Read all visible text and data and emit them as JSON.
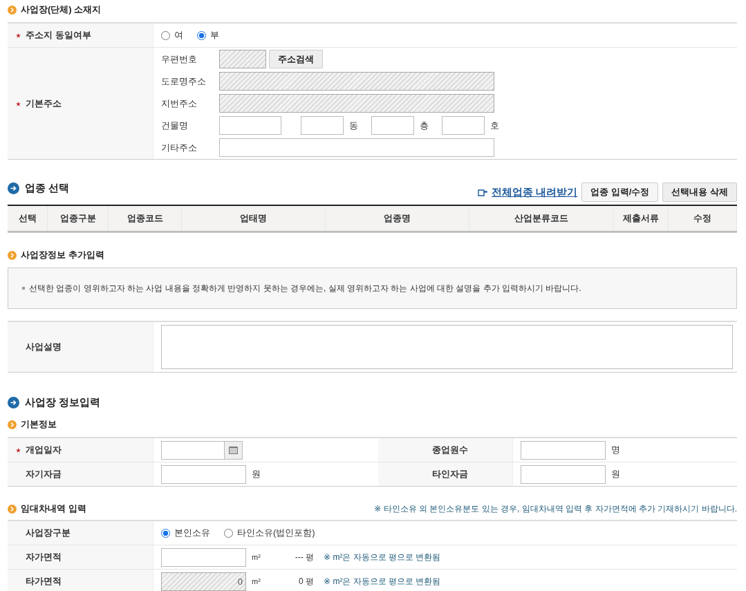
{
  "location": {
    "title": "사업장(단체) 소재지",
    "same_address": {
      "label": "주소지 동일여부",
      "required": true,
      "options": [
        {
          "label": "여",
          "selected": false
        },
        {
          "label": "부",
          "selected": true
        }
      ]
    },
    "basic_address": {
      "label": "기본주소",
      "required": true,
      "fields": [
        {
          "kind": "postcode",
          "label": "우편번호",
          "disabled": true,
          "button": "주소검색"
        },
        {
          "kind": "wide",
          "label": "도로명주소",
          "disabled": true
        },
        {
          "kind": "wide",
          "label": "지번주소",
          "disabled": true
        },
        {
          "kind": "building",
          "label": "건물명",
          "units": [
            "동",
            "층",
            "호"
          ]
        },
        {
          "kind": "wide",
          "label": "기타주소",
          "disabled": false
        }
      ]
    }
  },
  "industry": {
    "title": "업종 선택",
    "download_link": "전체업종 내려받기",
    "buttons": [
      "업종 입력/수정",
      "선택내용 삭제"
    ],
    "columns": [
      "선택",
      "업종구분",
      "업종코드",
      "업태명",
      "업종명",
      "산업분류코드",
      "제출서류",
      "수정"
    ]
  },
  "extra_info": {
    "title": "사업장정보 추가입력",
    "notice": "선택한 업종이 영위하고자 하는 사업 내용을 정확하게 반영하지 못하는 경우에는, 실제 영위하고자 하는 사업에 대한 설명을 추가 입력하시기 바랍니다.",
    "description": {
      "label": "사업설명"
    }
  },
  "business_info": {
    "title": "사업장 정보입력",
    "basic": {
      "title": "기본정보",
      "rows": [
        [
          {
            "label": "개업일자",
            "required": true,
            "kind": "date"
          },
          {
            "label": "종업원수",
            "required": false,
            "kind": "text",
            "unit": "명"
          }
        ],
        [
          {
            "label": "자기자금",
            "required": false,
            "kind": "text",
            "unit": "원"
          },
          {
            "label": "타인자금",
            "required": false,
            "kind": "text",
            "unit": "원"
          }
        ]
      ]
    },
    "lease": {
      "title": "임대차내역 입력",
      "notice": "※ 타인소유 외 본인소유분도 있는 경우, 임대차내역 입력 후 자가면적에 추가 기재하시기 바랍니다.",
      "rows": [
        {
          "kind": "radio",
          "label": "사업장구분",
          "options": [
            {
              "label": "본인소유",
              "selected": true
            },
            {
              "label": "타인소유(법인포함)",
              "selected": false
            }
          ]
        },
        {
          "kind": "area",
          "label": "자가면적",
          "disabled": false,
          "value": "",
          "unit": "m²",
          "pyeong": "---",
          "pyeong_unit": "평",
          "note": "※ m²은 자동으로 평으로 변환됨"
        },
        {
          "kind": "area",
          "label": "타가면적",
          "disabled": true,
          "value": "0",
          "unit": "m²",
          "pyeong": "0",
          "pyeong_unit": "평",
          "note": "※ m²은 자동으로 평으로 변환됨"
        }
      ]
    }
  }
}
